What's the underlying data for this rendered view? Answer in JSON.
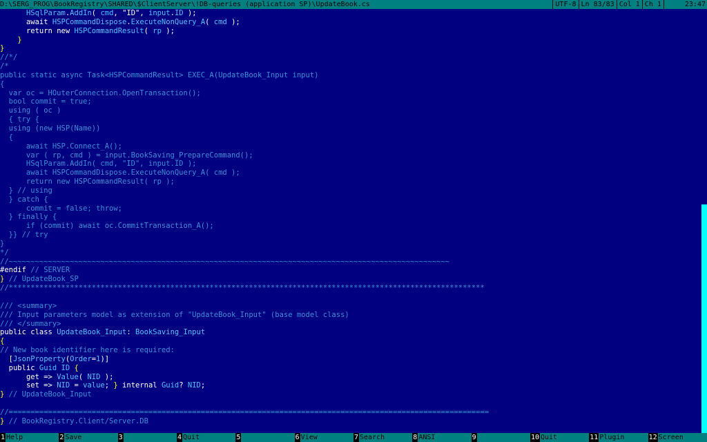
{
  "status_bar": {
    "path": "D:\\SERG_PROG\\BookRegistry\\SHARED\\$ClientServer\\!DB-queries (application SP)\\UpdateBook.cs",
    "encoding": "UTF-8",
    "line": "Ln 83/83",
    "column": "Col 1",
    "char": "Ch 1",
    "time": "23:47"
  },
  "code_lines": [
    [
      [
        "n",
        "      "
      ],
      [
        "id",
        "HSqlParam"
      ],
      [
        "n",
        "."
      ],
      [
        "id",
        "AddIn"
      ],
      [
        "n",
        "( "
      ],
      [
        "id",
        "cmd"
      ],
      [
        "n",
        ", "
      ],
      [
        "st",
        "\"ID\""
      ],
      [
        "n",
        ", "
      ],
      [
        "id",
        "input"
      ],
      [
        "n",
        "."
      ],
      [
        "id",
        "ID"
      ],
      [
        "n",
        " );"
      ]
    ],
    [
      [
        "n",
        "      "
      ],
      [
        "kw",
        "await "
      ],
      [
        "id",
        "HSPCommandDispose"
      ],
      [
        "n",
        "."
      ],
      [
        "id",
        "ExecuteNonQuery_A"
      ],
      [
        "n",
        "( "
      ],
      [
        "id",
        "cmd"
      ],
      [
        "n",
        " );"
      ]
    ],
    [
      [
        "n",
        "      "
      ],
      [
        "kw",
        "return new "
      ],
      [
        "id",
        "HSPCommandResult"
      ],
      [
        "n",
        "( "
      ],
      [
        "id",
        "rp"
      ],
      [
        "n",
        " );"
      ]
    ],
    [
      [
        "n",
        "    "
      ],
      [
        "br",
        "}"
      ]
    ],
    [
      [
        "br",
        "}"
      ]
    ],
    [
      [
        "cm",
        "//*/"
      ]
    ],
    [
      [
        "cm",
        "/*"
      ]
    ],
    [
      [
        "cm",
        "public static async Task<HSPCommandResult> EXEC_A(UpdateBook_Input input)"
      ]
    ],
    [
      [
        "cm",
        "{"
      ]
    ],
    [
      [
        "cm",
        "  var oc = HOuterConnection.OpenTransaction();"
      ]
    ],
    [
      [
        "cm",
        "  bool commit = true;"
      ]
    ],
    [
      [
        "cm",
        "  using ( oc )"
      ]
    ],
    [
      [
        "cm",
        "  { try {"
      ]
    ],
    [
      [
        "cm",
        "  using (new HSP(Name))"
      ]
    ],
    [
      [
        "cm",
        "  {"
      ]
    ],
    [
      [
        "cm",
        "      await HSP.Connect_A();"
      ]
    ],
    [
      [
        "cm",
        "      var ( rp, cmd ) = input.BookSaving_PrepareCommand();"
      ]
    ],
    [
      [
        "cm",
        "      HSqlParam.AddIn( cmd, \"ID\", input.ID );"
      ]
    ],
    [
      [
        "cm",
        "      await HSPCommandDispose.ExecuteNonQuery_A( cmd );"
      ]
    ],
    [
      [
        "cm",
        "      return new HSPCommandResult( rp );"
      ]
    ],
    [
      [
        "cm",
        "  } // using"
      ]
    ],
    [
      [
        "cm",
        "  } catch {"
      ]
    ],
    [
      [
        "cm",
        "      commit = false; throw;"
      ]
    ],
    [
      [
        "cm",
        "  } finally {"
      ]
    ],
    [
      [
        "cm",
        "      if (commit) await oc.CommitTransaction_A();"
      ]
    ],
    [
      [
        "cm",
        "  }} // try"
      ]
    ],
    [
      [
        "cm",
        "}"
      ]
    ],
    [
      [
        "cm",
        "*/"
      ]
    ],
    [
      [
        "cm",
        "//~~~~~~~~~~~~~~~~~~~~~~~~~~~~~~~~~~~~~~~~~~~~~~~~~~~~~~~~~~~~~~~~~~~~~~~~~~~~~~~~~~~~~~~~~~~~~~~~~~~~~"
      ]
    ],
    [
      [
        "kw",
        "#endif"
      ],
      [
        "cm",
        " // SERVER"
      ]
    ],
    [
      [
        "br",
        "}"
      ],
      [
        "cm",
        " // UpdateBook_SP"
      ]
    ],
    [
      [
        "cm",
        "//*************************************************************************************************************"
      ]
    ],
    [
      [
        "n",
        ""
      ]
    ],
    [
      [
        "cm",
        "/// <summary>"
      ]
    ],
    [
      [
        "cm",
        "/// Input parameters model as extension of \"UpdateBook_Input\" (base model class)"
      ]
    ],
    [
      [
        "cm",
        "/// </summary>"
      ]
    ],
    [
      [
        "kw",
        "public class "
      ],
      [
        "id",
        "UpdateBook_Input"
      ],
      [
        "n",
        ": "
      ],
      [
        "id",
        "BookSaving_Input"
      ]
    ],
    [
      [
        "br",
        "{"
      ]
    ],
    [
      [
        "cm",
        "// New book identifier here is required:"
      ]
    ],
    [
      [
        "n",
        "  "
      ],
      [
        "n",
        "["
      ],
      [
        "id",
        "JsonProperty"
      ],
      [
        "n",
        "("
      ],
      [
        "id",
        "Order"
      ],
      [
        "n",
        "="
      ],
      [
        "id",
        "1"
      ],
      [
        "n",
        ")]"
      ]
    ],
    [
      [
        "n",
        "  "
      ],
      [
        "kw",
        "public "
      ],
      [
        "id",
        "Guid ID"
      ],
      [
        "n",
        " "
      ],
      [
        "br",
        "{"
      ]
    ],
    [
      [
        "n",
        "      "
      ],
      [
        "kw",
        "get"
      ],
      [
        "n",
        " => "
      ],
      [
        "id",
        "Value"
      ],
      [
        "n",
        "( "
      ],
      [
        "id",
        "NID"
      ],
      [
        "n",
        " );"
      ]
    ],
    [
      [
        "n",
        "      "
      ],
      [
        "kw",
        "set"
      ],
      [
        "n",
        " => "
      ],
      [
        "id",
        "NID"
      ],
      [
        "n",
        " = "
      ],
      [
        "id",
        "value"
      ],
      [
        "n",
        "; "
      ],
      [
        "br",
        "}"
      ],
      [
        "n",
        " internal "
      ],
      [
        "id",
        "Guid"
      ],
      [
        "n",
        "? "
      ],
      [
        "id",
        "NID"
      ],
      [
        "n",
        ";"
      ]
    ],
    [
      [
        "br",
        "}"
      ],
      [
        "cm",
        " // UpdateBook_Input"
      ]
    ],
    [
      [
        "n",
        ""
      ]
    ],
    [
      [
        "cm",
        "//=============================================================================================================="
      ]
    ],
    [
      [
        "br",
        "}"
      ],
      [
        "cm",
        " // BookRegistry.Client/Server.DB"
      ]
    ]
  ],
  "keybar": [
    {
      "num": "1",
      "label": "Help"
    },
    {
      "num": "2",
      "label": "Save"
    },
    {
      "num": "3",
      "label": ""
    },
    {
      "num": "4",
      "label": "Quit"
    },
    {
      "num": "5",
      "label": ""
    },
    {
      "num": "6",
      "label": "View"
    },
    {
      "num": "7",
      "label": "Search"
    },
    {
      "num": "8",
      "label": "ANSI"
    },
    {
      "num": "9",
      "label": ""
    },
    {
      "num": "10",
      "label": "Quit"
    },
    {
      "num": "11",
      "label": "Plugin"
    },
    {
      "num": "12",
      "label": "Screen"
    }
  ],
  "colors": {
    "background": "#000080",
    "status_bar": "#008080",
    "identifier": "#4fc3ff",
    "bracket": "#ffff00",
    "comment": "#3a8fd6",
    "scroll_thumb": "#00ffff"
  }
}
